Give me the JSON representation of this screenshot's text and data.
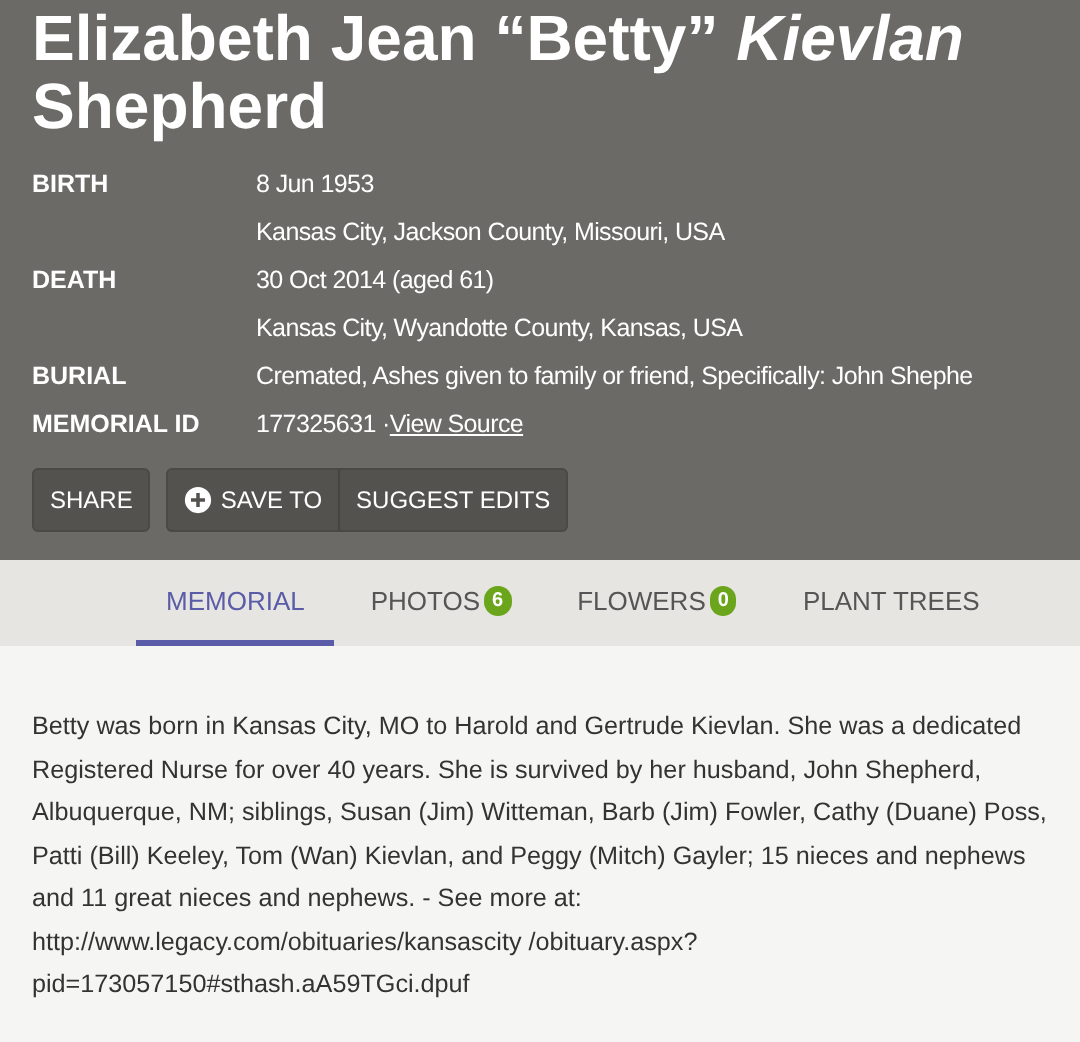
{
  "memorial": {
    "name": "Elizabeth Jean “Betty” *Kievlan* Shepherd",
    "facts": [
      {
        "label": "BIRTH",
        "lines": [
          "8 Jun 1953",
          "Kansas City, Jackson County, Missouri, USA"
        ]
      },
      {
        "label": "DEATH",
        "lines": [
          "30 Oct 2014 (aged 61)",
          "Kansas City, Wyandotte County, Kansas, USA"
        ]
      },
      {
        "label": "BURIAL",
        "lines": [
          "Cremated, Ashes given to family or friend, Specifically: John Shephe"
        ]
      },
      {
        "label": "MEMORIAL ID",
        "lines": [
          "177325631 ·"
        ],
        "link": "View Source"
      }
    ],
    "buttons": [
      {
        "label": "SHARE",
        "kind": "single"
      },
      {
        "label": "SAVE TO",
        "kind": "group-icon"
      },
      {
        "label": "SUGGEST EDITS",
        "kind": "group"
      }
    ]
  },
  "tabs": [
    {
      "label": "MEMORIAL",
      "selected": true
    },
    {
      "label": "PHOTOS",
      "selected": false,
      "count": "6"
    },
    {
      "label": "FLOWERS",
      "selected": false,
      "count": "0"
    },
    {
      "label": "PLANT TREES",
      "selected": false
    }
  ],
  "bio": "Betty was born in Kansas City, MO to Harold and Gertrude Kievlan. She was a dedicated Registered Nurse for over 40 years. She is survived by her husband, John Shepherd, Albuquerque, NM; siblings, Susan (Jim) Witteman, Barb (Jim) Fowler, Cathy (Duane) Poss, Patti (Bill) Keeley, Tom (Wan) Kievlan, and Peggy (Mitch) Gayler; 15 nieces and nephews and 11 great nieces and nephews. - See more at: http://www.legacy.com/obituaries/kansascity /obituary.aspx?pid=173057150#sthash.aA59TGci.dpuf"
}
